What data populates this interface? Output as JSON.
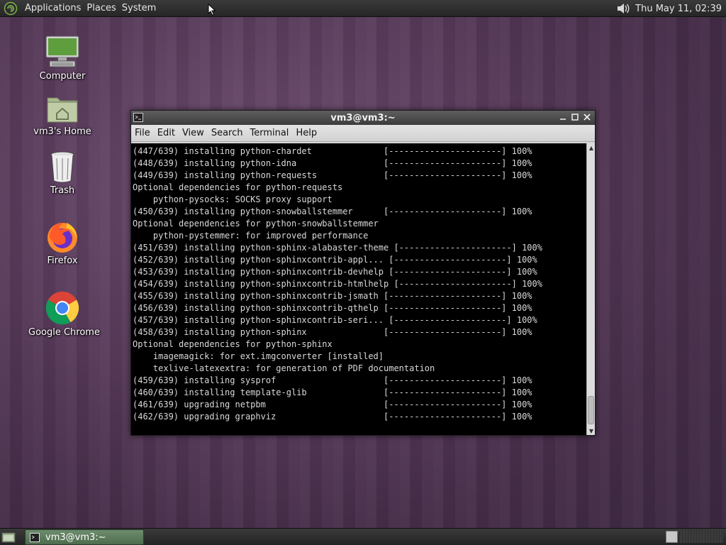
{
  "top_panel": {
    "menus": [
      "Applications",
      "Places",
      "System"
    ],
    "clock": "Thu May 11, 02:39",
    "icons": {
      "logo": "distro-logo-icon",
      "volume": "volume-icon"
    }
  },
  "desktop": {
    "icons": [
      {
        "label": "Computer",
        "icon": "computer-icon"
      },
      {
        "label": "vm3's Home",
        "icon": "home-folder-icon"
      },
      {
        "label": "Trash",
        "icon": "trash-icon"
      },
      {
        "label": "Firefox",
        "icon": "firefox-icon"
      },
      {
        "label": "Google Chrome",
        "icon": "chrome-icon"
      }
    ]
  },
  "terminal": {
    "title": "vm3@vm3:~",
    "menus": [
      "File",
      "Edit",
      "View",
      "Search",
      "Terminal",
      "Help"
    ],
    "lines": [
      "(447/639) installing python-chardet              [----------------------] 100%",
      "(448/639) installing python-idna                 [----------------------] 100%",
      "(449/639) installing python-requests             [----------------------] 100%",
      "Optional dependencies for python-requests",
      "    python-pysocks: SOCKS proxy support",
      "(450/639) installing python-snowballstemmer      [----------------------] 100%",
      "Optional dependencies for python-snowballstemmer",
      "    python-pystemmer: for improved performance",
      "(451/639) installing python-sphinx-alabaster-theme [----------------------] 100%",
      "(452/639) installing python-sphinxcontrib-appl... [----------------------] 100%",
      "(453/639) installing python-sphinxcontrib-devhelp [----------------------] 100%",
      "(454/639) installing python-sphinxcontrib-htmlhelp [----------------------] 100%",
      "(455/639) installing python-sphinxcontrib-jsmath [----------------------] 100%",
      "(456/639) installing python-sphinxcontrib-qthelp [----------------------] 100%",
      "(457/639) installing python-sphinxcontrib-seri... [----------------------] 100%",
      "(458/639) installing python-sphinx               [----------------------] 100%",
      "Optional dependencies for python-sphinx",
      "    imagemagick: for ext.imgconverter [installed]",
      "    texlive-latexextra: for generation of PDF documentation",
      "(459/639) installing sysprof                     [----------------------] 100%",
      "(460/639) installing template-glib               [----------------------] 100%",
      "(461/639) upgrading netpbm                       [----------------------] 100%",
      "(462/639) upgrading graphviz                     [----------------------] 100%"
    ]
  },
  "bottom_panel": {
    "task_label": "vm3@vm3:~"
  }
}
